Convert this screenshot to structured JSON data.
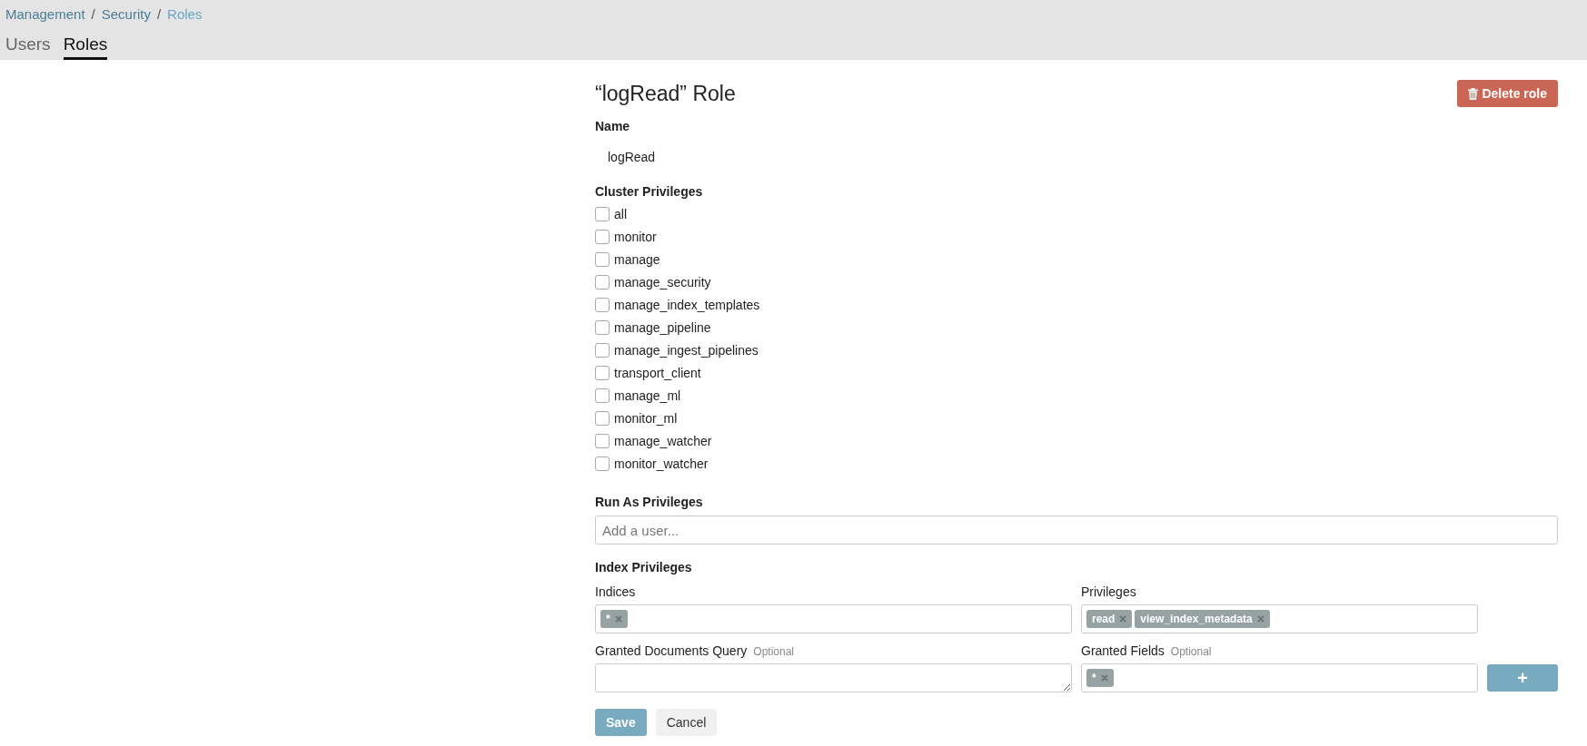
{
  "breadcrumbs": [
    {
      "label": "Management",
      "current": false
    },
    {
      "label": "Security",
      "current": false
    },
    {
      "label": "Roles",
      "current": true
    }
  ],
  "breadcrumb_separator": "/",
  "tabs": [
    {
      "label": "Users",
      "selected": false
    },
    {
      "label": "Roles",
      "selected": true
    }
  ],
  "title": "“logRead” Role",
  "delete_button": "Delete role",
  "name": {
    "label": "Name",
    "value": "logRead"
  },
  "cluster_privileges": {
    "label": "Cluster Privileges",
    "items": [
      {
        "label": "all",
        "checked": false
      },
      {
        "label": "monitor",
        "checked": false
      },
      {
        "label": "manage",
        "checked": false
      },
      {
        "label": "manage_security",
        "checked": false
      },
      {
        "label": "manage_index_templates",
        "checked": false
      },
      {
        "label": "manage_pipeline",
        "checked": false
      },
      {
        "label": "manage_ingest_pipelines",
        "checked": false
      },
      {
        "label": "transport_client",
        "checked": false
      },
      {
        "label": "manage_ml",
        "checked": false
      },
      {
        "label": "monitor_ml",
        "checked": false
      },
      {
        "label": "manage_watcher",
        "checked": false
      },
      {
        "label": "monitor_watcher",
        "checked": false
      }
    ]
  },
  "run_as": {
    "label": "Run As Privileges",
    "placeholder": "Add a user..."
  },
  "index_privileges": {
    "label": "Index Privileges",
    "indices": {
      "label": "Indices",
      "tags": [
        "*"
      ]
    },
    "privileges": {
      "label": "Privileges",
      "tags": [
        "read",
        "view_index_metadata"
      ]
    },
    "query": {
      "label": "Granted Documents Query",
      "hint": "Optional"
    },
    "fields": {
      "label": "Granted Fields",
      "hint": "Optional",
      "tags": [
        "*"
      ]
    },
    "add_button": "+"
  },
  "buttons": {
    "save": "Save",
    "cancel": "Cancel"
  }
}
